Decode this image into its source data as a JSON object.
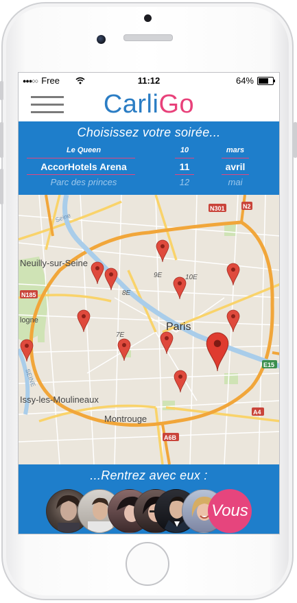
{
  "status": {
    "carrier": "Free",
    "signal_dots": "●●●○○",
    "time": "11:12",
    "battery": "64%"
  },
  "header": {
    "logo_part1": "Carli",
    "logo_part2": "Go"
  },
  "picker": {
    "title": "Choisissez votre soirée...",
    "rows": [
      {
        "venue": "Le Queen",
        "day": "10",
        "month": "mars"
      },
      {
        "venue": "AccorHotels Arena",
        "day": "11",
        "month": "avril"
      },
      {
        "venue": "Parc des princes",
        "day": "12",
        "month": "mai"
      }
    ]
  },
  "map": {
    "labels": {
      "paris": "Paris",
      "neuilly": "Neuilly-sur-Seine",
      "issy": "Issy-les-Moulineaux",
      "montrouge": "Montrouge",
      "logne": "logne",
      "seine_top": "Seine",
      "seine_left": "SEINE",
      "ar9e": "9E",
      "ar10e": "10E",
      "ar8e": "8E",
      "ar7e": "7E",
      "n301": "N301",
      "n2": "N2",
      "n185": "N185",
      "e15": "E15",
      "a4": "A4",
      "a6b": "A6B"
    }
  },
  "bottom": {
    "title": "...Rentrez avec eux :",
    "vous": "Vous"
  },
  "colors": {
    "brand_blue": "#1e7ecb",
    "brand_pink": "#e6457d",
    "logo_blue": "#2b7dc4"
  }
}
